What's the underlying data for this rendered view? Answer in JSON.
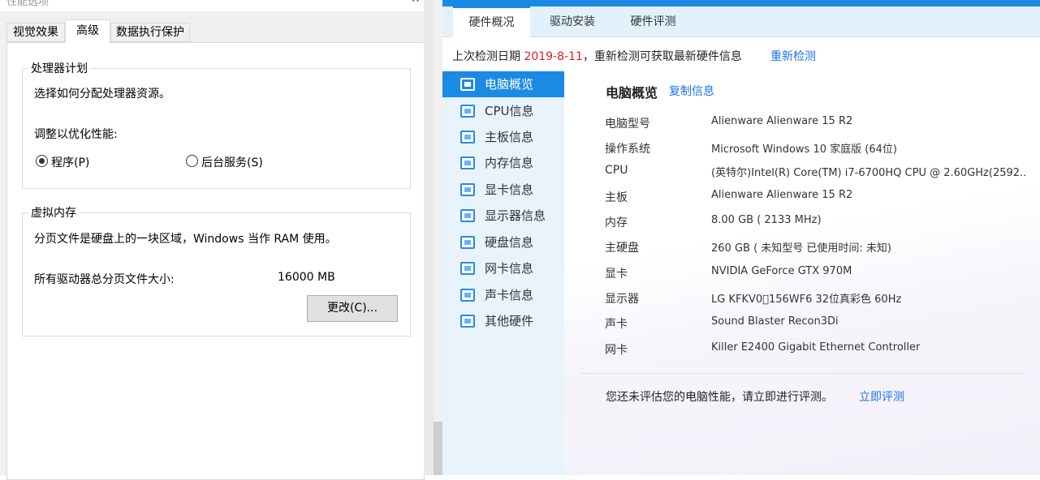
{
  "perf_dialog": {
    "title": "性能选项",
    "close_glyph": "✕",
    "tabs": [
      "视觉效果",
      "高级",
      "数据执行保护"
    ],
    "processor_group": {
      "title": "处理器计划",
      "desc": "选择如何分配处理器资源。",
      "optimize_label": "调整以优化性能:",
      "option_programs": "程序(P)",
      "option_services": "后台服务(S)",
      "selected": "程序(P)"
    },
    "vm_group": {
      "title": "虚拟内存",
      "desc": "分页文件是硬盘上的一块区域，Windows 当作 RAM 使用。",
      "total_label": "所有驱动器总分页文件大小:",
      "total_value": "16000 MB",
      "change_button": "更改(C)..."
    }
  },
  "hw_app": {
    "accent_color": "#1b8ae5",
    "tabs": [
      "硬件概况",
      "驱动安装",
      "硬件评测"
    ],
    "detect": {
      "prefix": "上次检测日期",
      "date": "2019-8-11",
      "suffix": "，重新检测可获取最新硬件信息",
      "redetect_link": "重新检测"
    },
    "sidebar": [
      {
        "label": "电脑概览",
        "icon": "monitor-overview-icon"
      },
      {
        "label": "CPU信息",
        "icon": "cpu-icon"
      },
      {
        "label": "主板信息",
        "icon": "motherboard-icon"
      },
      {
        "label": "内存信息",
        "icon": "memory-icon"
      },
      {
        "label": "显卡信息",
        "icon": "gpu-icon"
      },
      {
        "label": "显示器信息",
        "icon": "display-icon"
      },
      {
        "label": "硬盘信息",
        "icon": "disk-icon"
      },
      {
        "label": "网卡信息",
        "icon": "network-card-icon"
      },
      {
        "label": "声卡信息",
        "icon": "sound-card-icon"
      },
      {
        "label": "其他硬件",
        "icon": "other-hardware-icon"
      }
    ],
    "overview": {
      "title": "电脑概览",
      "copy_link": "复制信息",
      "specs": [
        {
          "key": "电脑型号",
          "value": "Alienware Alienware 15 R2"
        },
        {
          "key": "操作系统",
          "value": "Microsoft Windows 10 家庭版 (64位)"
        },
        {
          "key": "CPU",
          "value": "(英特尔)Intel(R) Core(TM) i7-6700HQ CPU @ 2.60GHz(2592..."
        },
        {
          "key": "主板",
          "value": "Alienware Alienware 15 R2"
        },
        {
          "key": "内存",
          "value": "8.00 GB (  2133 MHz)"
        },
        {
          "key": "主硬盘",
          "value": "260 GB ( 未知型号 已使用时间: 未知)"
        },
        {
          "key": "显卡",
          "value": "NVIDIA GeForce GTX 970M"
        },
        {
          "key": "显示器",
          "value": "LG KFKV0\u0000156WF6 32位真彩色 60Hz"
        },
        {
          "key": "声卡",
          "value": "Sound Blaster Recon3Di"
        },
        {
          "key": "网卡",
          "value": "Killer E2400 Gigabit Ethernet Controller"
        }
      ],
      "eval_text": "您还未评估您的电脑性能，请立即进行评测。",
      "eval_link": "立即评测"
    }
  }
}
